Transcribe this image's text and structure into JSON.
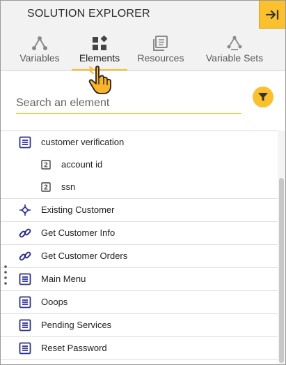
{
  "header": {
    "title": "SOLUTION EXPLORER",
    "collapse_icon": "arrow-right-to-bar-icon"
  },
  "tabs": [
    {
      "label": "Variables",
      "icon": "share-nodes-icon",
      "active": false
    },
    {
      "label": "Elements",
      "icon": "shapes-icon",
      "active": true
    },
    {
      "label": "Resources",
      "icon": "stacked-documents-icon",
      "active": false
    },
    {
      "label": "Variable Sets",
      "icon": "variable-sets-icon",
      "active": false
    }
  ],
  "search": {
    "placeholder": "Search an element",
    "value": ""
  },
  "filter": {
    "icon": "filter-icon"
  },
  "elements": [
    {
      "label": "customer verification",
      "icon": "list-doc-icon"
    },
    {
      "label": "account id",
      "icon": "number-2-icon",
      "child": true
    },
    {
      "label": "ssn",
      "icon": "number-2-icon",
      "child": true
    },
    {
      "label": "Existing Customer",
      "icon": "diamond-node-icon"
    },
    {
      "label": "Get Customer Info",
      "icon": "link-icon"
    },
    {
      "label": "Get Customer Orders",
      "icon": "link-icon"
    },
    {
      "label": "Main Menu",
      "icon": "list-doc-icon"
    },
    {
      "label": "Ooops",
      "icon": "list-doc-icon"
    },
    {
      "label": "Pending Services",
      "icon": "list-doc-icon"
    },
    {
      "label": "Reset Password",
      "icon": "list-doc-icon"
    }
  ],
  "colors": {
    "accent": "#fbc02d",
    "icon_navy": "#2c2f8f",
    "tab_icon_gray": "#8a8a8a"
  }
}
